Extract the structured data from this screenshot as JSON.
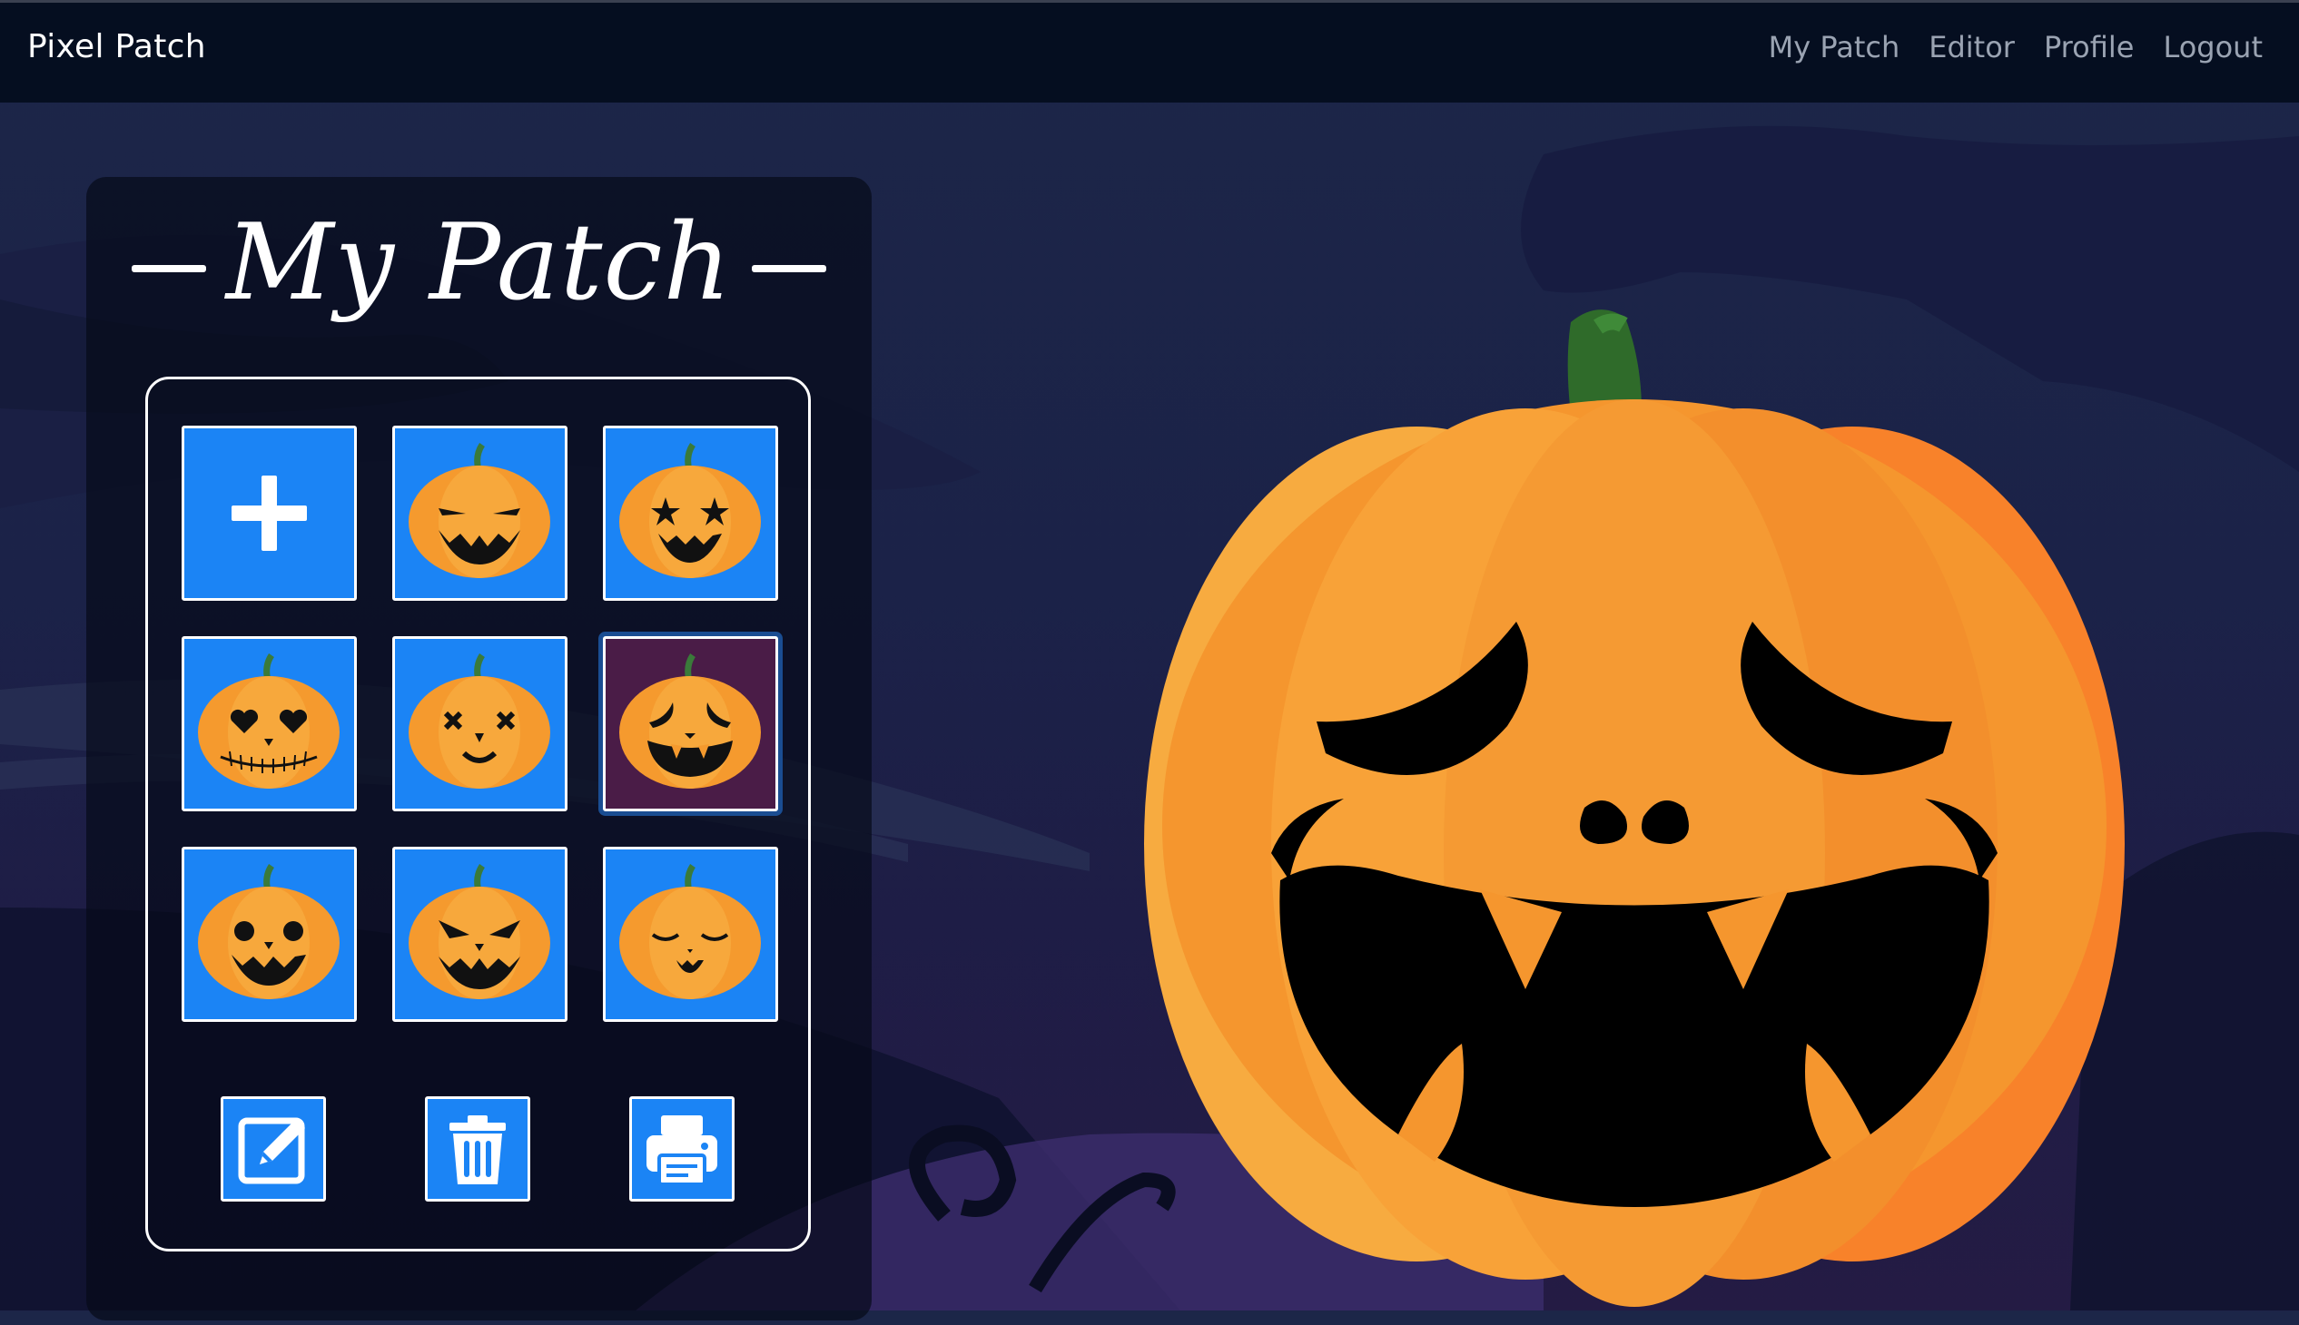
{
  "navbar": {
    "brand": "Pixel Patch",
    "links": [
      "My Patch",
      "Editor",
      "Profile",
      "Logout"
    ]
  },
  "panel": {
    "title": "My Patch"
  },
  "tiles": [
    {
      "face": "add",
      "selected": false
    },
    {
      "face": "sly",
      "selected": false
    },
    {
      "face": "star-eyes",
      "selected": false
    },
    {
      "face": "heart-eyes-stitched",
      "selected": false
    },
    {
      "face": "x-eyes",
      "selected": false
    },
    {
      "face": "sad-fangs",
      "selected": true
    },
    {
      "face": "round-eyes",
      "selected": false
    },
    {
      "face": "angry",
      "selected": false
    },
    {
      "face": "sleepy",
      "selected": false
    }
  ],
  "actions": [
    "edit-icon",
    "trash-icon",
    "print-icon"
  ],
  "preview": {
    "face": "sad-fangs"
  },
  "colors": {
    "accent": "#1b84f5",
    "selected_tile": "#4a1c47",
    "pumpkin": "#f5962e",
    "navbar": "#050e20"
  }
}
